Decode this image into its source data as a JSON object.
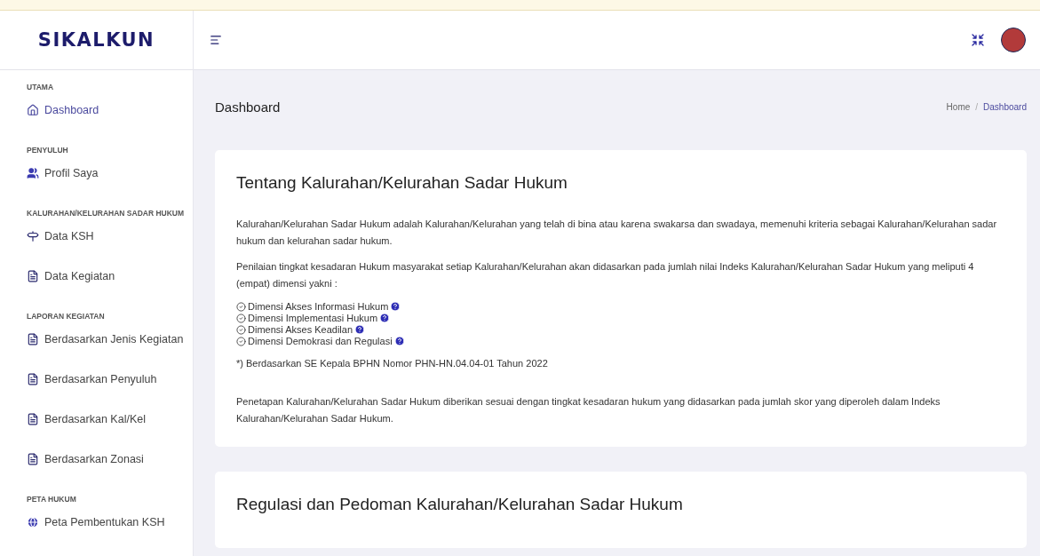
{
  "brand": {
    "logo": "SIKALKUN"
  },
  "sidebar": {
    "sections": [
      {
        "heading": "UTAMA",
        "items": [
          {
            "label": "Dashboard",
            "kind": "home",
            "selected": true
          }
        ]
      },
      {
        "heading": "PENYULUH",
        "items": [
          {
            "label": "Profil Saya",
            "kind": "users",
            "selected": false
          }
        ]
      },
      {
        "heading": "KALURAHAN/KELURAHAN SADAR HUKUM",
        "items": [
          {
            "label": "Data KSH",
            "kind": "signpost",
            "selected": false
          },
          {
            "label": "Data Kegiatan",
            "kind": "file",
            "selected": false
          }
        ]
      },
      {
        "heading": "LAPORAN KEGIATAN",
        "items": [
          {
            "label": "Berdasarkan Jenis Kegiatan",
            "kind": "file",
            "selected": false
          },
          {
            "label": "Berdasarkan Penyuluh",
            "kind": "file",
            "selected": false
          },
          {
            "label": "Berdasarkan Kal/Kel",
            "kind": "file",
            "selected": false
          },
          {
            "label": "Berdasarkan Zonasi",
            "kind": "file",
            "selected": false
          }
        ]
      },
      {
        "heading": "PETA HUKUM",
        "items": [
          {
            "label": "Peta Pembentukan KSH",
            "kind": "globe",
            "selected": false
          }
        ]
      }
    ]
  },
  "page": {
    "title": "Dashboard",
    "breadcrumb": [
      {
        "label": "Home",
        "selected": false
      },
      {
        "label": "Dashboard",
        "selected": true
      }
    ],
    "separator": "/"
  },
  "cards": [
    {
      "title": "Tentang Kalurahan/Kelurahan Sadar Hukum",
      "blocks": [
        {
          "kind": "paragraph",
          "text": "Kalurahan/Kelurahan Sadar Hukum adalah Kalurahan/Kelurahan yang telah di bina atau karena swakarsa dan swadaya, memenuhi kriteria sebagai Kalurahan/Kelurahan sadar hukum dan kelurahan sadar hukum."
        },
        {
          "kind": "paragraph",
          "text": "Penilaian tingkat kesadaran Hukum masyarakat setiap Kalurahan/Kelurahan akan didasarkan pada jumlah nilai Indeks Kalurahan/Kelurahan Sadar Hukum yang meliputi 4 (empat) dimensi yakni :"
        },
        {
          "kind": "checklist",
          "items": [
            "Dimensi Akses Informasi Hukum",
            "Dimensi Implementasi Hukum",
            "Dimensi Akses Keadilan",
            "Dimensi Demokrasi dan Regulasi"
          ]
        },
        {
          "kind": "note",
          "text": "*) Berdasarkan SE Kepala BPHN Nomor PHN-HN.04.04-01 Tahun 2022"
        },
        {
          "kind": "paragraph",
          "text": "Penetapan Kalurahan/Kelurahan Sadar Hukum diberikan sesuai dengan tingkat kesadaran hukum yang didasarkan pada jumlah skor yang diperoleh dalam Indeks Kalurahan/Kelurahan Sadar Hukum."
        }
      ]
    },
    {
      "title": "Regulasi dan Pedoman Kalurahan/Kelurahan Sadar Hukum"
    }
  ]
}
